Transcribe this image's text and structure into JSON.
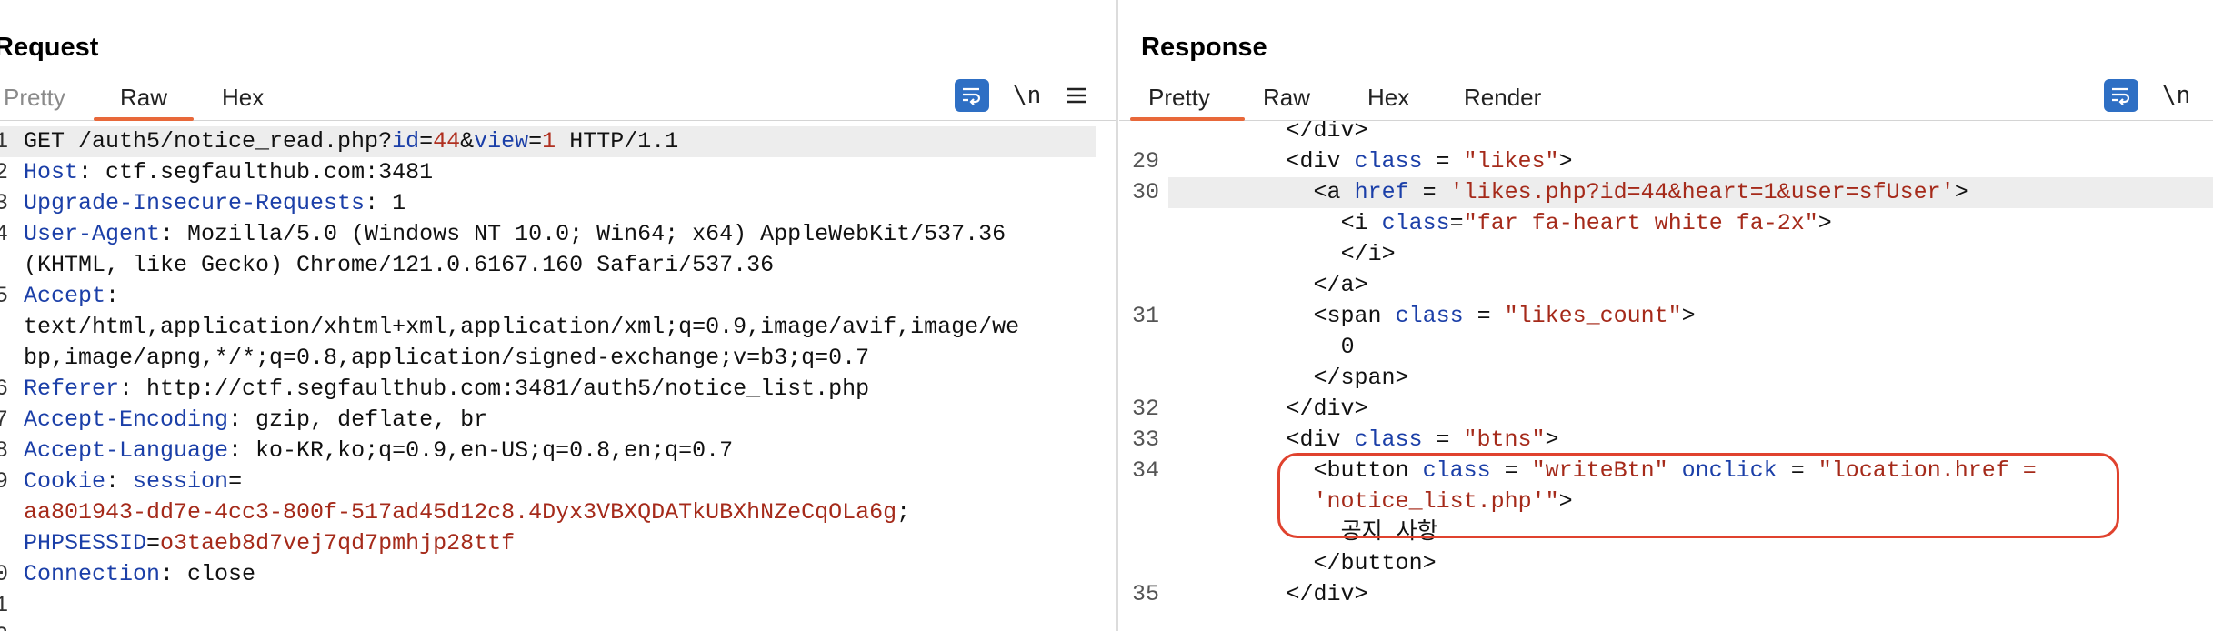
{
  "request": {
    "title": "Request",
    "tabs": [
      {
        "label": "Pretty",
        "active": false
      },
      {
        "label": "Raw",
        "active": true
      },
      {
        "label": "Hex",
        "active": false
      }
    ],
    "newline_toggle": "\\n",
    "lines": [
      {
        "n": "1",
        "segments": [
          {
            "t": "GET /auth5/notice_read.php?",
            "c": "h-val"
          },
          {
            "t": "id",
            "c": "k-param"
          },
          {
            "t": "=",
            "c": "h-val"
          },
          {
            "t": "44",
            "c": "v-param"
          },
          {
            "t": "&",
            "c": "h-val"
          },
          {
            "t": "view",
            "c": "k-param"
          },
          {
            "t": "=",
            "c": "h-val"
          },
          {
            "t": "1",
            "c": "v-param"
          },
          {
            "t": " HTTP/1.1",
            "c": "h-val"
          }
        ]
      },
      {
        "n": "2",
        "segments": [
          {
            "t": "Host",
            "c": "h-name"
          },
          {
            "t": ": ctf.segfaulthub.com:3481",
            "c": "h-val"
          }
        ]
      },
      {
        "n": "3",
        "segments": [
          {
            "t": "Upgrade-Insecure-Requests",
            "c": "h-name"
          },
          {
            "t": ": 1",
            "c": "h-val"
          }
        ]
      },
      {
        "n": "4",
        "segments": [
          {
            "t": "User-Agent",
            "c": "h-name"
          },
          {
            "t": ": Mozilla/5.0 (Windows NT 10.0; Win64; x64) AppleWebKit/537.36",
            "c": "h-val"
          }
        ]
      },
      {
        "n": "",
        "segments": [
          {
            "t": "(KHTML, like Gecko) Chrome/121.0.6167.160 Safari/537.36",
            "c": "h-val"
          }
        ]
      },
      {
        "n": "5",
        "segments": [
          {
            "t": "Accept",
            "c": "h-name"
          },
          {
            "t": ":",
            "c": "h-val"
          }
        ]
      },
      {
        "n": "",
        "segments": [
          {
            "t": "text/html,application/xhtml+xml,application/xml;q=0.9,image/avif,image/we",
            "c": "h-val"
          }
        ]
      },
      {
        "n": "",
        "segments": [
          {
            "t": "bp,image/apng,*/*;q=0.8,application/signed-exchange;v=b3;q=0.7",
            "c": "h-val"
          }
        ]
      },
      {
        "n": "6",
        "segments": [
          {
            "t": "Referer",
            "c": "h-name"
          },
          {
            "t": ": http://ctf.segfaulthub.com:3481/auth5/notice_list.php",
            "c": "h-val"
          }
        ]
      },
      {
        "n": "7",
        "segments": [
          {
            "t": "Accept-Encoding",
            "c": "h-name"
          },
          {
            "t": ": gzip, deflate, br",
            "c": "h-val"
          }
        ]
      },
      {
        "n": "8",
        "segments": [
          {
            "t": "Accept-Language",
            "c": "h-name"
          },
          {
            "t": ": ko-KR,ko;q=0.9,en-US;q=0.8,en;q=0.7",
            "c": "h-val"
          }
        ]
      },
      {
        "n": "9",
        "segments": [
          {
            "t": "Cookie",
            "c": "h-name"
          },
          {
            "t": ": ",
            "c": "h-val"
          },
          {
            "t": "session",
            "c": "cookie-key"
          },
          {
            "t": "=",
            "c": "h-val"
          }
        ]
      },
      {
        "n": "",
        "segments": [
          {
            "t": "aa801943-dd7e-4cc3-800f-517ad45d12c8.4Dyx3VBXQDATkUBXhNZeCqOLa6g",
            "c": "cookie-val"
          },
          {
            "t": ";",
            "c": "h-val"
          }
        ]
      },
      {
        "n": "",
        "segments": [
          {
            "t": "PHPSESSID",
            "c": "cookie-key"
          },
          {
            "t": "=",
            "c": "h-val"
          },
          {
            "t": "o3taeb8d7vej7qd7pmhjp28ttf",
            "c": "cookie-val"
          }
        ]
      },
      {
        "n": "0",
        "segments": [
          {
            "t": "Connection",
            "c": "h-name"
          },
          {
            "t": ": close",
            "c": "h-val"
          }
        ]
      },
      {
        "n": "1",
        "segments": []
      },
      {
        "n": "2",
        "segments": []
      }
    ]
  },
  "response": {
    "title": "Response",
    "tabs": [
      {
        "label": "Pretty",
        "active": true
      },
      {
        "label": "Raw",
        "active": false
      },
      {
        "label": "Hex",
        "active": false
      },
      {
        "label": "Render",
        "active": false
      }
    ],
    "newline_toggle": "\\n",
    "lines": [
      {
        "n": "",
        "indent": 9,
        "segments": [
          {
            "t": "</div>",
            "c": "tag"
          }
        ]
      },
      {
        "n": "29",
        "indent": 9,
        "segments": [
          {
            "t": "<div ",
            "c": "tag"
          },
          {
            "t": "class",
            "c": "attr"
          },
          {
            "t": " = ",
            "c": "tag"
          },
          {
            "t": "\"likes\"",
            "c": "str"
          },
          {
            "t": ">",
            "c": "tag"
          }
        ]
      },
      {
        "n": "30",
        "indent": 11,
        "segments": [
          {
            "t": "<a ",
            "c": "tag"
          },
          {
            "t": "href",
            "c": "attr"
          },
          {
            "t": " = ",
            "c": "tag"
          },
          {
            "t": "'likes.php?id=44&heart=1&user=sfUser'",
            "c": "str"
          },
          {
            "t": ">",
            "c": "tag"
          }
        ]
      },
      {
        "n": "",
        "indent": 13,
        "segments": [
          {
            "t": "<i ",
            "c": "tag"
          },
          {
            "t": "class",
            "c": "attr"
          },
          {
            "t": "=",
            "c": "tag"
          },
          {
            "t": "\"far fa-heart white fa-2x\"",
            "c": "str"
          },
          {
            "t": ">",
            "c": "tag"
          }
        ]
      },
      {
        "n": "",
        "indent": 13,
        "segments": [
          {
            "t": "</i>",
            "c": "tag"
          }
        ]
      },
      {
        "n": "",
        "indent": 11,
        "segments": [
          {
            "t": "</a>",
            "c": "tag"
          }
        ]
      },
      {
        "n": "31",
        "indent": 11,
        "segments": [
          {
            "t": "<span ",
            "c": "tag"
          },
          {
            "t": "class",
            "c": "attr"
          },
          {
            "t": " = ",
            "c": "tag"
          },
          {
            "t": "\"likes_count\"",
            "c": "str"
          },
          {
            "t": ">",
            "c": "tag"
          }
        ]
      },
      {
        "n": "",
        "indent": 13,
        "segments": [
          {
            "t": "0",
            "c": "tag"
          }
        ]
      },
      {
        "n": "",
        "indent": 11,
        "segments": [
          {
            "t": "</span>",
            "c": "tag"
          }
        ]
      },
      {
        "n": "32",
        "indent": 9,
        "segments": [
          {
            "t": "</div>",
            "c": "tag"
          }
        ]
      },
      {
        "n": "33",
        "indent": 9,
        "segments": [
          {
            "t": "<div ",
            "c": "tag"
          },
          {
            "t": "class",
            "c": "attr"
          },
          {
            "t": " = ",
            "c": "tag"
          },
          {
            "t": "\"btns\"",
            "c": "str"
          },
          {
            "t": ">",
            "c": "tag"
          }
        ]
      },
      {
        "n": "34",
        "indent": 11,
        "segments": [
          {
            "t": "<button ",
            "c": "tag"
          },
          {
            "t": "class",
            "c": "attr"
          },
          {
            "t": " = ",
            "c": "tag"
          },
          {
            "t": "\"writeBtn\"",
            "c": "str"
          },
          {
            "t": " ",
            "c": "tag"
          },
          {
            "t": "onclick",
            "c": "attr"
          },
          {
            "t": " = ",
            "c": "tag"
          },
          {
            "t": "\"location.href =",
            "c": "str"
          }
        ]
      },
      {
        "n": "",
        "indent": 11,
        "segments": [
          {
            "t": "'notice_list.php'\"",
            "c": "str"
          },
          {
            "t": ">",
            "c": "tag"
          }
        ]
      },
      {
        "n": "",
        "indent": 13,
        "segments": [
          {
            "t": "공지 사항",
            "c": "tag"
          }
        ]
      },
      {
        "n": "",
        "indent": 11,
        "segments": [
          {
            "t": "</button>",
            "c": "tag"
          }
        ]
      },
      {
        "n": "35",
        "indent": 9,
        "segments": [
          {
            "t": "</div>",
            "c": "tag"
          }
        ]
      }
    ]
  },
  "icons": {
    "wrap": "text-wrap-icon",
    "menu": "hamburger-menu-icon",
    "layout_split": "split-columns-icon",
    "layout_rows": "split-rows-icon",
    "layout_single": "single-pane-icon"
  },
  "colors": {
    "accent": "#e8683a",
    "button_blue": "#2e6fc4",
    "annotation": "#e0422e"
  }
}
